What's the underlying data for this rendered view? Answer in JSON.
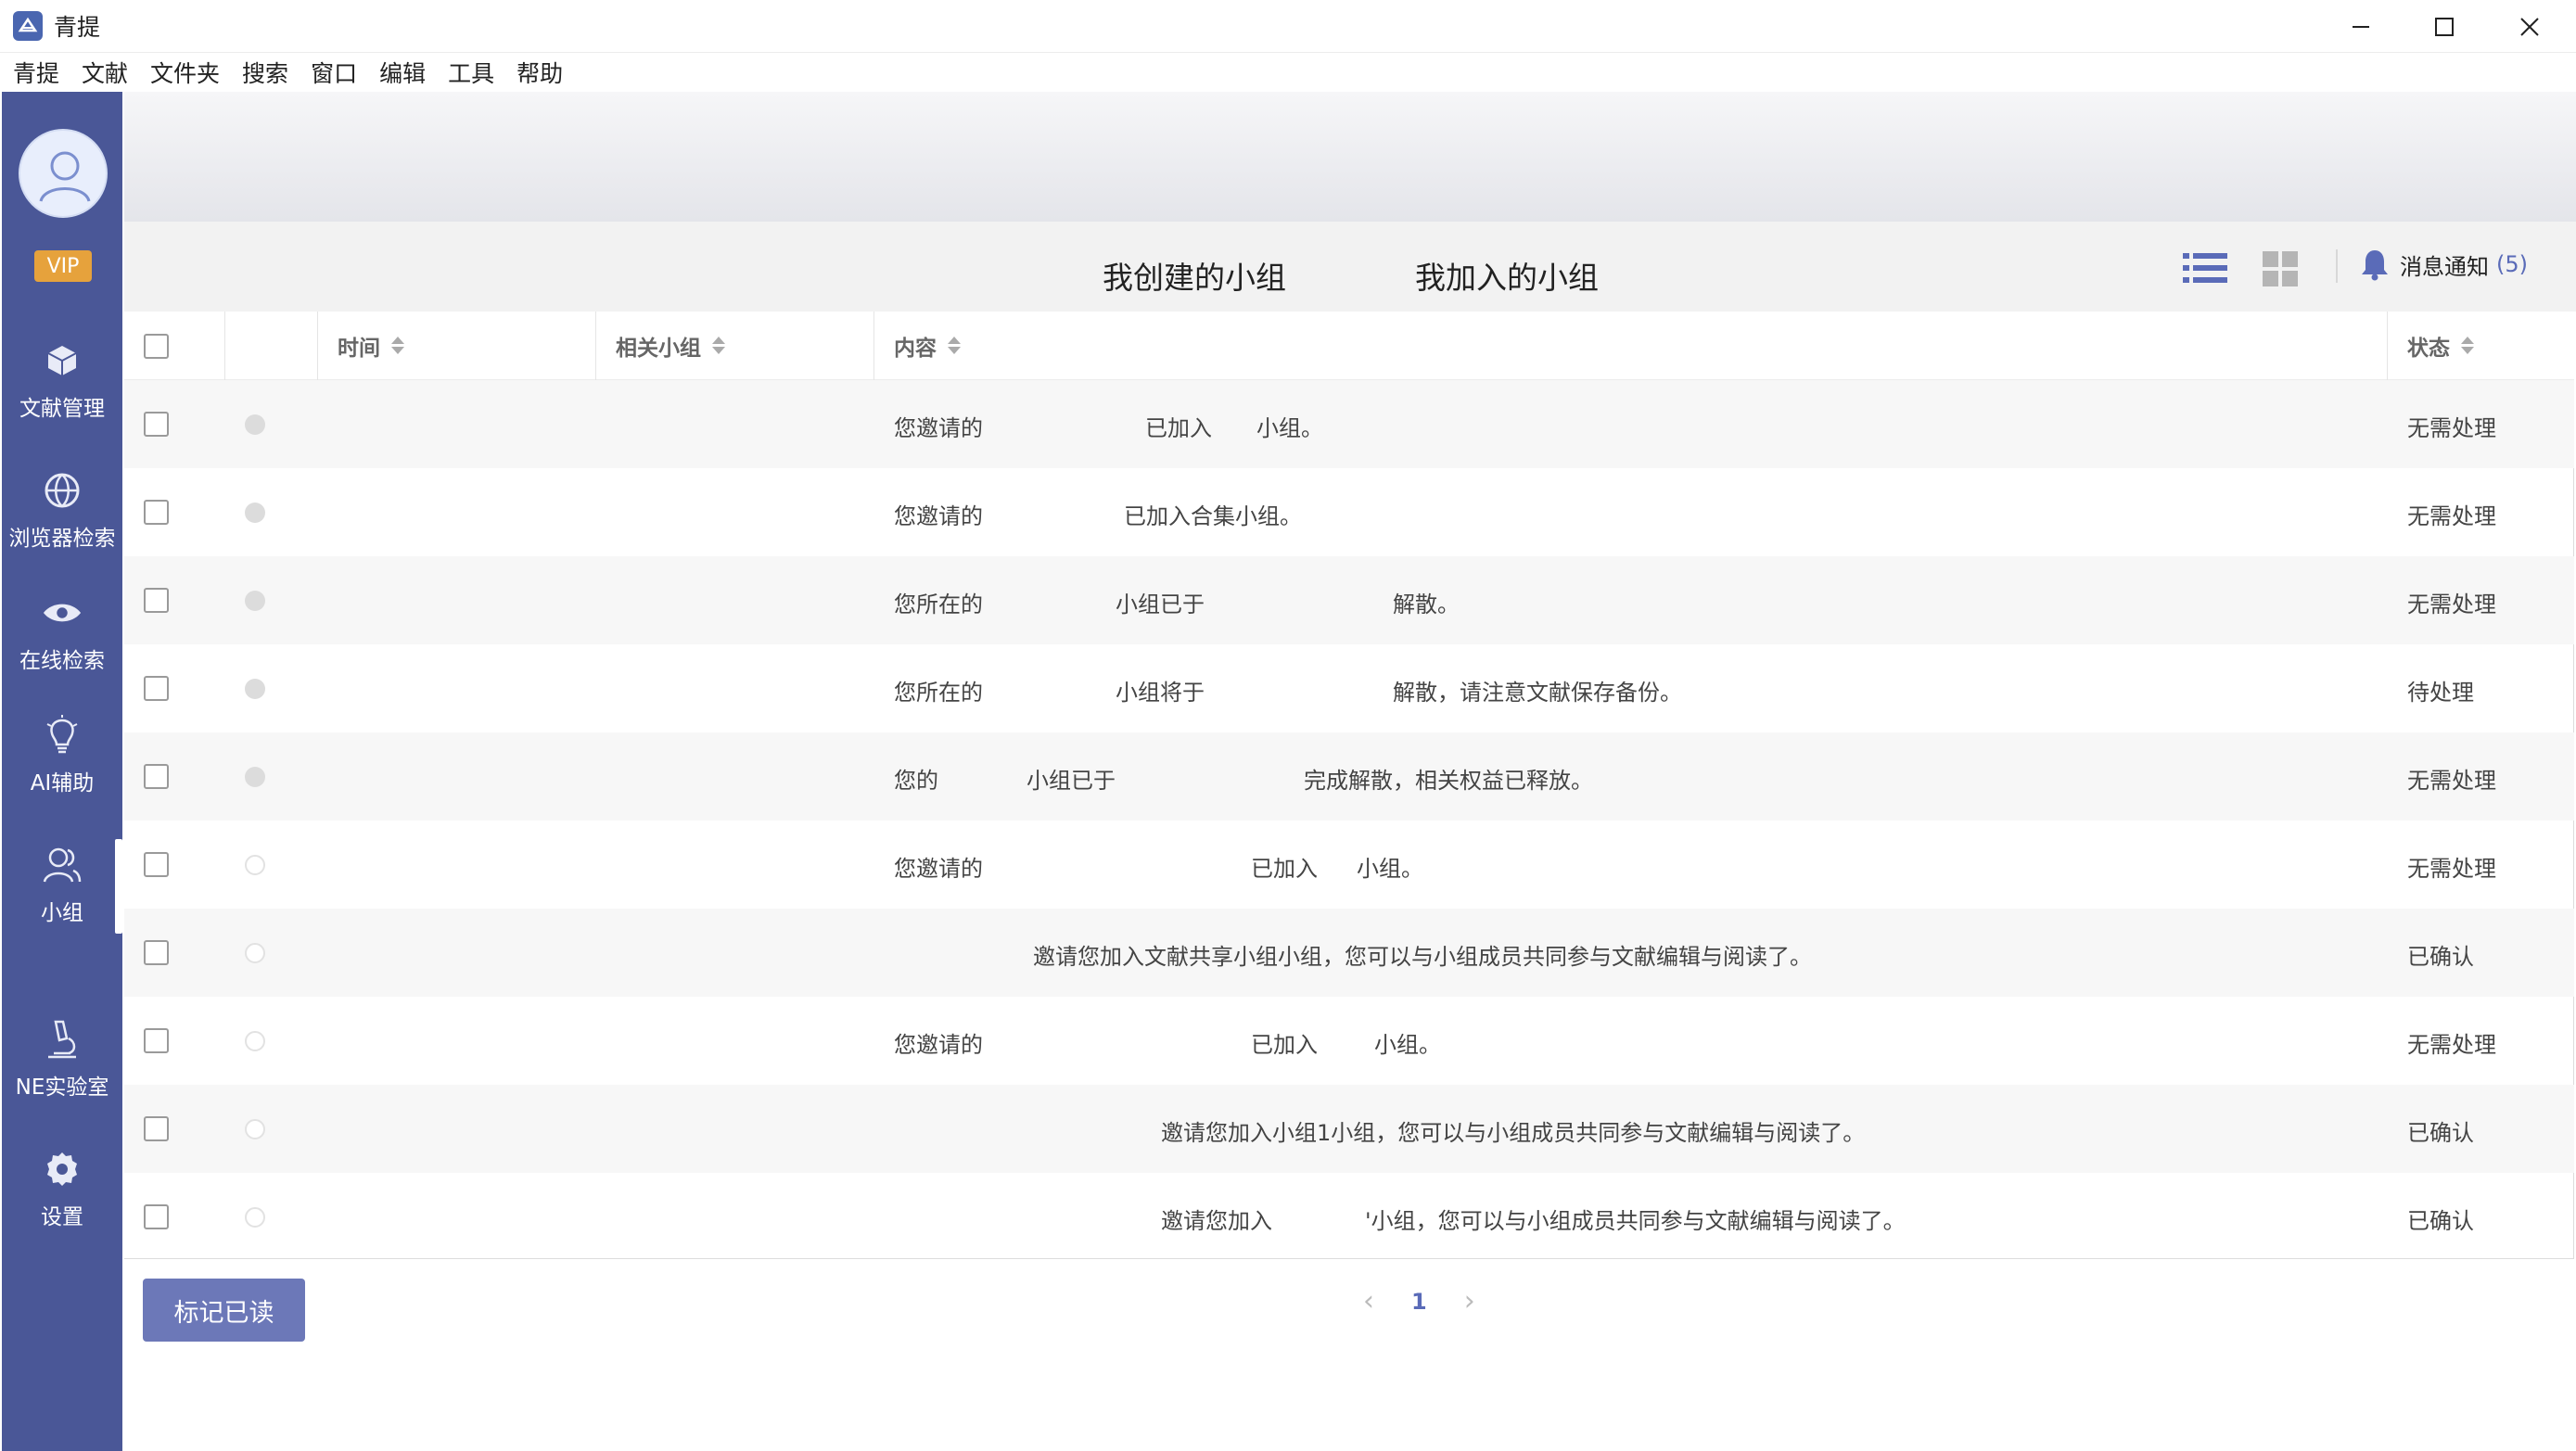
{
  "window": {
    "title": "青提",
    "logo_icon": "qingti-logo",
    "controls": {
      "minimize": "—",
      "maximize": "☐",
      "close": "✕"
    }
  },
  "menu": [
    "青提",
    "文献",
    "文件夹",
    "搜索",
    "窗口",
    "编辑",
    "工具",
    "帮助"
  ],
  "sidebar": {
    "vip_label": "VIP",
    "items": [
      {
        "label": "文献管理",
        "icon": "cube-icon"
      },
      {
        "label": "浏览器检索",
        "icon": "basketball-globe-icon"
      },
      {
        "label": "在线检索",
        "icon": "eye-icon"
      },
      {
        "label": "AI辅助",
        "icon": "lightbulb-icon"
      },
      {
        "label": "小组",
        "icon": "users-icon",
        "active": true
      },
      {
        "label": "NE实验室",
        "icon": "microscope-icon"
      },
      {
        "label": "设置",
        "icon": "gear-icon"
      }
    ]
  },
  "tabs": {
    "created": "我创建的小组",
    "joined": "我加入的小组"
  },
  "notifications": {
    "label": "消息通知",
    "count": "(5)"
  },
  "table": {
    "headers": {
      "time": "时间",
      "group": "相关小组",
      "content": "内容",
      "status": "状态"
    },
    "rows": [
      {
        "read": false,
        "content": [
          "您邀请的",
          "已加入",
          "小组。"
        ],
        "status": "无需处理"
      },
      {
        "read": false,
        "content": [
          "您邀请的",
          "已加入合集小组。"
        ],
        "status": "无需处理"
      },
      {
        "read": false,
        "content": [
          "您所在的",
          "小组已于",
          "解散。"
        ],
        "status": "无需处理"
      },
      {
        "read": false,
        "content": [
          "您所在的",
          "小组将于",
          "解散，请注意文献保存备份。"
        ],
        "status": "待处理"
      },
      {
        "read": false,
        "content": [
          "您的",
          "小组已于",
          "完成解散，相关权益已释放。"
        ],
        "status": "无需处理"
      },
      {
        "read": true,
        "content": [
          "您邀请的",
          "已加入",
          "小组。"
        ],
        "status": "无需处理"
      },
      {
        "read": true,
        "content": [
          "邀请您加入文献共享小组小组，您可以与小组成员共同参与文献编辑与阅读了。"
        ],
        "status": "已确认"
      },
      {
        "read": true,
        "content": [
          "您邀请的",
          "已加入",
          "小组。"
        ],
        "status": "无需处理"
      },
      {
        "read": true,
        "content": [
          "邀请您加入小组1小组，您可以与小组成员共同参与文献编辑与阅读了。"
        ],
        "status": "已确认"
      },
      {
        "read": true,
        "content": [
          "邀请您加入",
          "'小组，您可以与小组成员共同参与文献编辑与阅读了。"
        ],
        "status": "已确认"
      }
    ]
  },
  "footer": {
    "mark_read": "标记已读",
    "prev": "‹",
    "page": "1",
    "next": "›"
  },
  "colors": {
    "sidebar": "#4a5797",
    "accent": "#5a6bb8",
    "button": "#6c78b8",
    "vip": "#e6a23c"
  }
}
